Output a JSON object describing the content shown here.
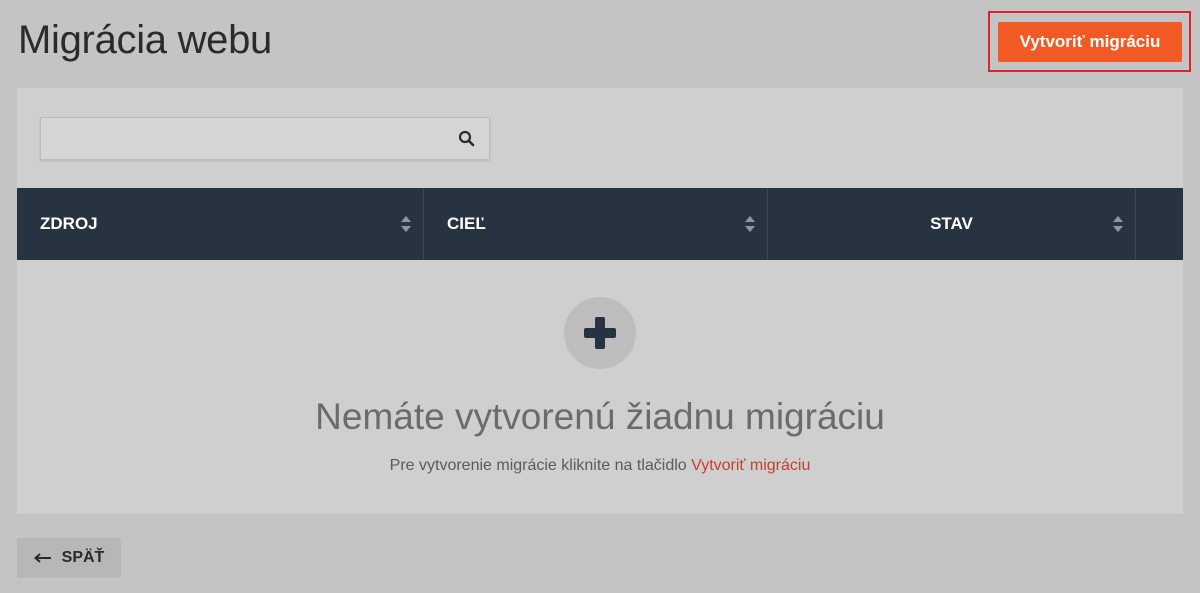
{
  "header": {
    "title": "Migrácia webu",
    "create_button_label": "Vytvoriť migráciu"
  },
  "search": {
    "value": "",
    "placeholder": "",
    "icon": "search-icon"
  },
  "table": {
    "columns": [
      {
        "label": "ZDROJ",
        "sortable": true
      },
      {
        "label": "CIEĽ",
        "sortable": true
      },
      {
        "label": "STAV",
        "sortable": true
      }
    ],
    "rows": []
  },
  "empty_state": {
    "icon": "plus-icon",
    "title": "Nemáte vytvorenú žiadnu migráciu",
    "subtitle_prefix": "Pre vytvorenie migrácie kliknite na tlačidlo ",
    "subtitle_link": "Vytvoriť migráciu"
  },
  "footer": {
    "back_label": "SPÄŤ",
    "back_icon": "arrow-left-icon"
  },
  "colors": {
    "accent": "#f15a24",
    "table_header": "#283341",
    "highlight": "#d9262d",
    "link": "#c8402a"
  }
}
